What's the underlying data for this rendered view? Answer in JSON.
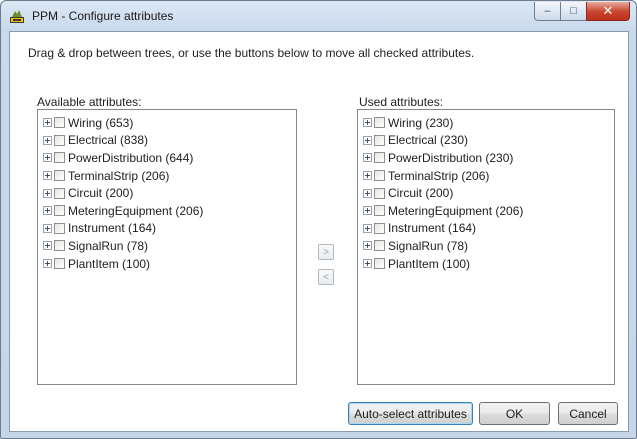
{
  "window": {
    "title": "PPM - Configure attributes",
    "icon": "app-icon",
    "controls": {
      "minimize": "–",
      "maximize": "□",
      "close": "✕"
    }
  },
  "instruction": "Drag & drop between trees, or use the buttons below to move all checked attributes.",
  "available": {
    "label": "Available attributes:",
    "items": [
      {
        "label": "Wiring (653)"
      },
      {
        "label": "Electrical (838)"
      },
      {
        "label": "PowerDistribution (644)"
      },
      {
        "label": "TerminalStrip (206)"
      },
      {
        "label": "Circuit (200)"
      },
      {
        "label": "MeteringEquipment (206)"
      },
      {
        "label": "Instrument (164)"
      },
      {
        "label": "SignalRun (78)"
      },
      {
        "label": "PlantItem (100)"
      }
    ]
  },
  "used": {
    "label": "Used attributes:",
    "items": [
      {
        "label": "Wiring (230)"
      },
      {
        "label": "Electrical (230)"
      },
      {
        "label": "PowerDistribution (230)"
      },
      {
        "label": "TerminalStrip (206)"
      },
      {
        "label": "Circuit (200)"
      },
      {
        "label": "MeteringEquipment (206)"
      },
      {
        "label": "Instrument (164)"
      },
      {
        "label": "SignalRun (78)"
      },
      {
        "label": "PlantItem (100)"
      }
    ]
  },
  "move_buttons": {
    "right": ">",
    "left": "<"
  },
  "buttons": {
    "auto_select": "Auto-select attributes",
    "ok": "OK",
    "cancel": "Cancel"
  }
}
